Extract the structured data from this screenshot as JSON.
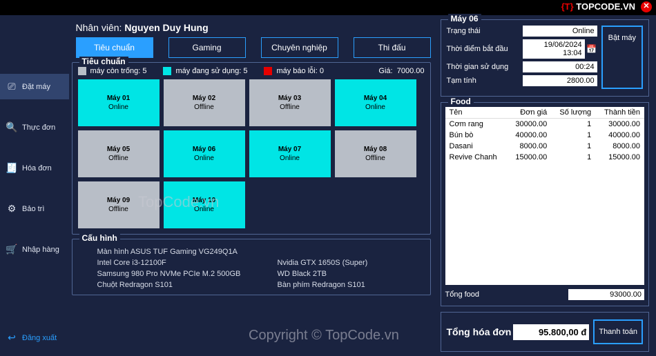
{
  "logo": {
    "bracket": "{T}",
    "text": "TOPCODE.VN"
  },
  "staff": {
    "label": "Nhân viên:",
    "name": "Nguyen Duy Hung"
  },
  "tabs": [
    {
      "label": "Tiêu chuẩn",
      "active": true
    },
    {
      "label": "Gaming",
      "active": false
    },
    {
      "label": "Chuyên nghiệp",
      "active": false
    },
    {
      "label": "Thi đấu",
      "active": false
    }
  ],
  "sidebar": [
    {
      "icon": "⎚",
      "label": "Đặt máy",
      "active": true
    },
    {
      "icon": "🔍",
      "label": "Thực đơn"
    },
    {
      "icon": "🧾",
      "label": "Hóa đơn"
    },
    {
      "icon": "⚙",
      "label": "Bảo trì"
    },
    {
      "icon": "🛒",
      "label": "Nhập hàng"
    }
  ],
  "logout": {
    "icon": "↩",
    "label": "Đăng xuất"
  },
  "tier": {
    "title": "Tiêu chuẩn",
    "free": {
      "label": "máy còn trống:",
      "val": "5"
    },
    "use": {
      "label": "máy đang sử dụng:",
      "val": "5"
    },
    "err": {
      "label": "máy báo lỗi:",
      "val": "0"
    },
    "price": {
      "label": "Giá:",
      "val": "7000.00"
    }
  },
  "machines": [
    {
      "name": "Máy 01",
      "status": "Online",
      "on": true
    },
    {
      "name": "Máy 02",
      "status": "Offline",
      "on": false
    },
    {
      "name": "Máy 03",
      "status": "Offline",
      "on": false
    },
    {
      "name": "Máy 04",
      "status": "Online",
      "on": true
    },
    {
      "name": "Máy 05",
      "status": "Offline",
      "on": false
    },
    {
      "name": "Máy 06",
      "status": "Online",
      "on": true
    },
    {
      "name": "Máy 07",
      "status": "Online",
      "on": true
    },
    {
      "name": "Máy 08",
      "status": "Offline",
      "on": false
    },
    {
      "name": "Máy 09",
      "status": "Offline",
      "on": false
    },
    {
      "name": "Máy 10",
      "status": "Online",
      "on": true
    }
  ],
  "config": {
    "title": "Cấu hình",
    "items": [
      "Màn hình ASUS TUF Gaming VG249Q1A",
      "",
      "Intel Core i3-12100F",
      "Nvidia GTX 1650S (Super)",
      "Samsung 980 Pro NVMe PCIe M.2 500GB",
      "WD Black 2TB",
      "Chuột Redragon S101",
      "Bàn phím Redragon S101"
    ]
  },
  "detail": {
    "title": "Máy 06",
    "rows": {
      "status": {
        "k": "Trạng thái",
        "v": "Online"
      },
      "start": {
        "k": "Thời điểm bắt đầu",
        "v": "19/06/2024 13:04"
      },
      "dur": {
        "k": "Thời gian sử dụng",
        "v": "00:24"
      },
      "sub": {
        "k": "Tạm tính",
        "v": "2800.00"
      }
    },
    "btn": "Bật máy"
  },
  "food": {
    "title": "Food",
    "head": [
      "Tên",
      "Đơn giá",
      "Số lượng",
      "Thành tiền"
    ],
    "rows": [
      [
        "Cơm rang",
        "30000.00",
        "1",
        "30000.00"
      ],
      [
        "Bún bò",
        "40000.00",
        "1",
        "40000.00"
      ],
      [
        "Dasani",
        "8000.00",
        "1",
        "8000.00"
      ],
      [
        "Revive Chanh",
        "15000.00",
        "1",
        "15000.00"
      ]
    ],
    "total": {
      "k": "Tổng food",
      "v": "93000.00"
    }
  },
  "final": {
    "k": "Tổng hóa đơn",
    "v": "95.800,00 đ",
    "btn": "Thanh toán"
  },
  "wm": {
    "a": "TopCode.vn",
    "b": "Copyright © TopCode.vn"
  }
}
